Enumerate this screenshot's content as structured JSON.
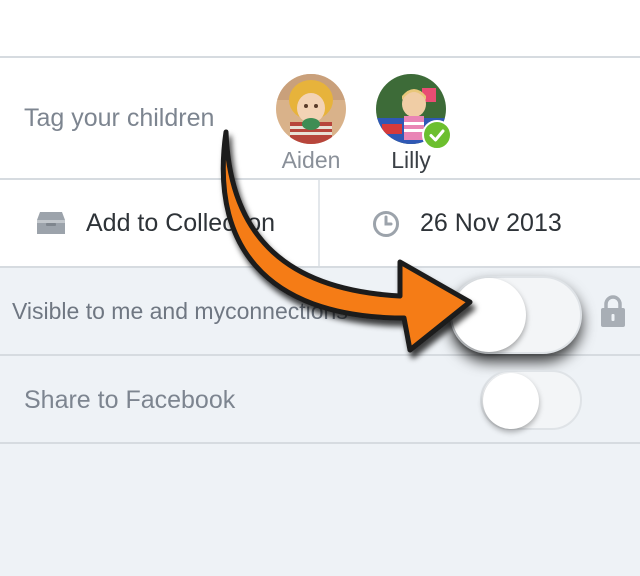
{
  "tagging": {
    "label": "Tag your children",
    "children": [
      {
        "name": "Aiden",
        "selected": false
      },
      {
        "name": "Lilly",
        "selected": true
      }
    ]
  },
  "collection": {
    "label": "Add to Collection",
    "icon": "inbox-tray-icon"
  },
  "date": {
    "label": "26 Nov 2013",
    "icon": "clock-icon"
  },
  "visibility": {
    "label": "Visible to me and myconnections",
    "toggle_on": false,
    "icon": "lock-icon"
  },
  "facebook": {
    "label": "Share to Facebook",
    "toggle_on": false
  },
  "annotation": {
    "arrow_color": "#f57c13",
    "points_to": "visibility-toggle"
  },
  "colors": {
    "check": "#6cbf2e",
    "divider": "#d6dbe0",
    "background": "#eef2f6"
  }
}
